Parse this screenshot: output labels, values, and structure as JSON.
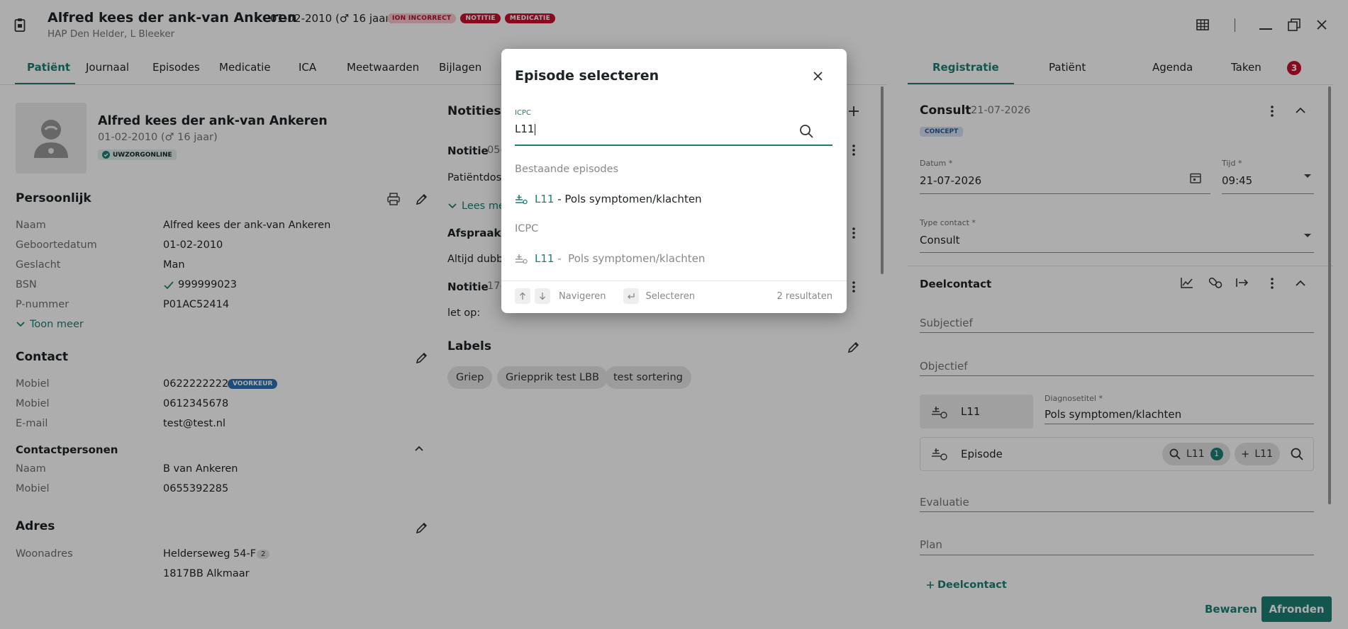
{
  "header": {
    "patient_name": "Alfred kees der ank-van Ankeren",
    "dob_age": "01-02-2010 (♂ 16 jaar)",
    "badges": [
      "ION INCORRECT",
      "NOTITIE",
      "MEDICATIE"
    ],
    "practice": "HAP Den Helder, L Bleeker"
  },
  "left_tabs": [
    "Patiënt",
    "Journaal",
    "Episodes",
    "Medicatie",
    "ICA",
    "Meetwaarden",
    "Bijlagen"
  ],
  "patient_card": {
    "name": "Alfred kees der ank-van Ankeren",
    "dob_age": "01-02-2010 (♂ 16 jaar)",
    "status": "UWZORGONLINE"
  },
  "persoonlijk": {
    "title": "Persoonlijk",
    "rows": [
      {
        "label": "Naam",
        "value": "Alfred kees der ank-van Ankeren"
      },
      {
        "label": "Geboortedatum",
        "value": "01-02-2010"
      },
      {
        "label": "Geslacht",
        "value": "Man"
      },
      {
        "label": "BSN",
        "value": "999999023"
      },
      {
        "label": "P-nummer",
        "value": "P01AC52414"
      }
    ],
    "toon_meer": "Toon meer"
  },
  "contact": {
    "title": "Contact",
    "rows": [
      {
        "label": "Mobiel",
        "value": "0622222222"
      },
      {
        "label": "Mobiel",
        "value": "0612345678"
      },
      {
        "label": "E-mail",
        "value": "test@test.nl"
      }
    ],
    "voorkeur": "VOORKEUR"
  },
  "contactpersonen": {
    "title": "Contactpersonen",
    "rows": [
      {
        "label": "Naam",
        "value": "B van Ankeren"
      },
      {
        "label": "Mobiel",
        "value": "0655392285"
      }
    ]
  },
  "adres": {
    "title": "Adres",
    "label": "Woonadres",
    "line1": "Helderseweg 54-F",
    "count": "2",
    "line2": "1817BB Alkmaar"
  },
  "notities": {
    "title": "Notities (3)",
    "items": [
      {
        "title": "Notitie",
        "date": "05-",
        "body": "Patiëntdoss"
      },
      {
        "title": "Afspraak n",
        "body": "Altijd dubbe"
      },
      {
        "title": "Notitie",
        "date": "17-0",
        "body": "let op:"
      }
    ],
    "lees_meer": "Lees me"
  },
  "labels": {
    "title": "Labels",
    "chips": [
      "Griep",
      "Griepprik test LBB",
      "test sortering"
    ]
  },
  "right_tabs": [
    "Registratie",
    "Patiënt",
    "Agenda",
    "Taken"
  ],
  "taken_count": "3",
  "consult": {
    "title": "Consult",
    "date": "21-07-2026",
    "status": "CONCEPT",
    "datum_label": "Datum *",
    "datum_value": "21-07-2026",
    "tijd_label": "Tijd *",
    "tijd_value": "09:45",
    "type_label": "Type contact *",
    "type_value": "Consult"
  },
  "deelcontact": {
    "title": "Deelcontact",
    "subjectief": "Subjectief",
    "objectief": "Objectief",
    "icpc_code": "L11",
    "diag_label": "Diagnosetitel *",
    "diag_value": "Pols symptomen/klachten",
    "episode_label": "Episode",
    "search_chip": "L11",
    "search_count": "1",
    "add_chip": "L11",
    "evaluatie": "Evaluatie",
    "plan": "Plan",
    "add_deelcontact": "Deelcontact"
  },
  "footer": {
    "bewaren": "Bewaren",
    "afronden": "Afronden"
  },
  "modal": {
    "title": "Episode selecteren",
    "input_label": "ICPC",
    "input_value": "L11",
    "section_existing": "Bestaande episodes",
    "existing": [
      {
        "code": "L11",
        "text": "- Pols symptomen/klachten"
      }
    ],
    "section_icpc": "ICPC",
    "icpc": [
      {
        "code": "L11",
        "text": "-  Pols symptomen/klachten"
      }
    ],
    "nav_label": "Navigeren",
    "select_label": "Selecteren",
    "results": "2 resultaten"
  },
  "colors": {
    "accent": "#1b7f73",
    "danger": "#c8102e"
  }
}
